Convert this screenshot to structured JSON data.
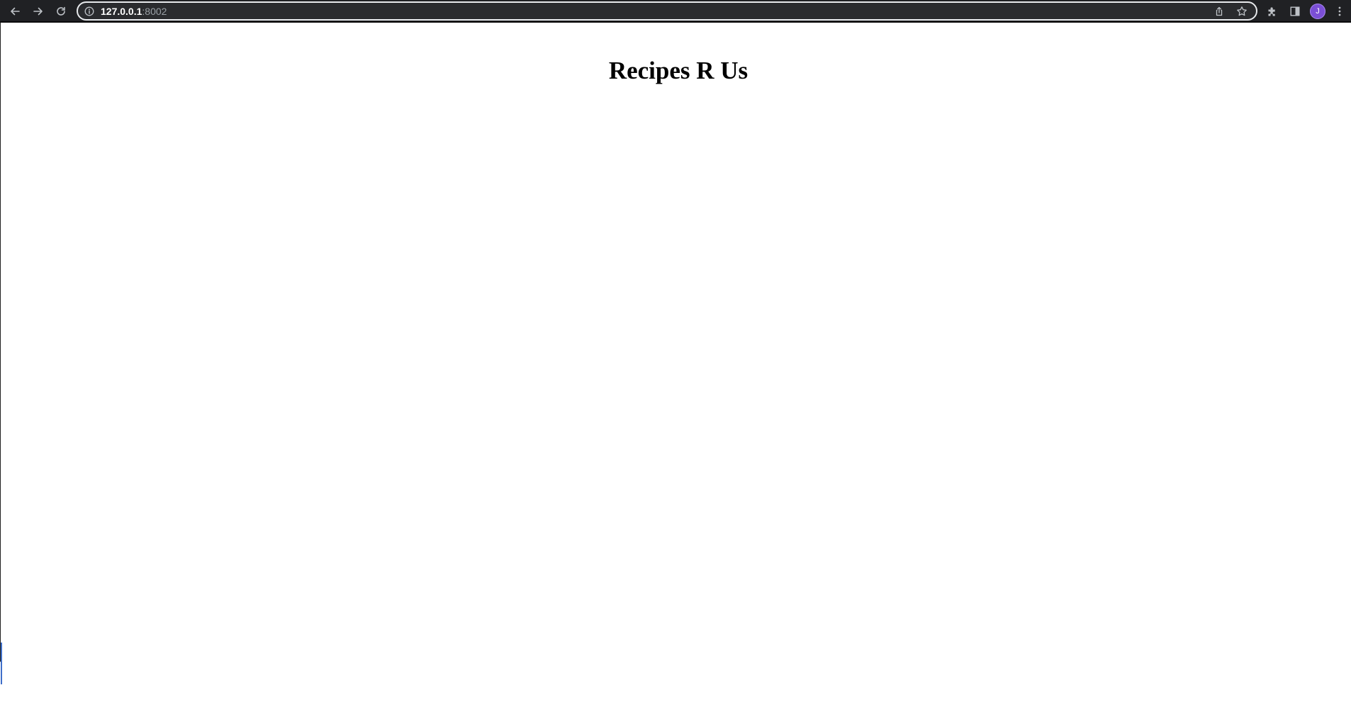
{
  "browser": {
    "url_host": "127.0.0.1",
    "url_port": ":8002",
    "profile_initial": "J",
    "icons": {
      "back": "arrow-left-icon",
      "forward": "arrow-right-icon",
      "reload": "reload-icon",
      "site_info": "info-icon",
      "share": "share-icon",
      "bookmark": "star-icon",
      "extensions": "puzzle-icon",
      "side_panel": "side-panel-icon",
      "menu": "kebab-menu-icon"
    },
    "colors": {
      "toolbar_bg": "#202124",
      "avatar_bg": "#7b4fd6"
    }
  },
  "page": {
    "title": "Recipes R Us"
  }
}
